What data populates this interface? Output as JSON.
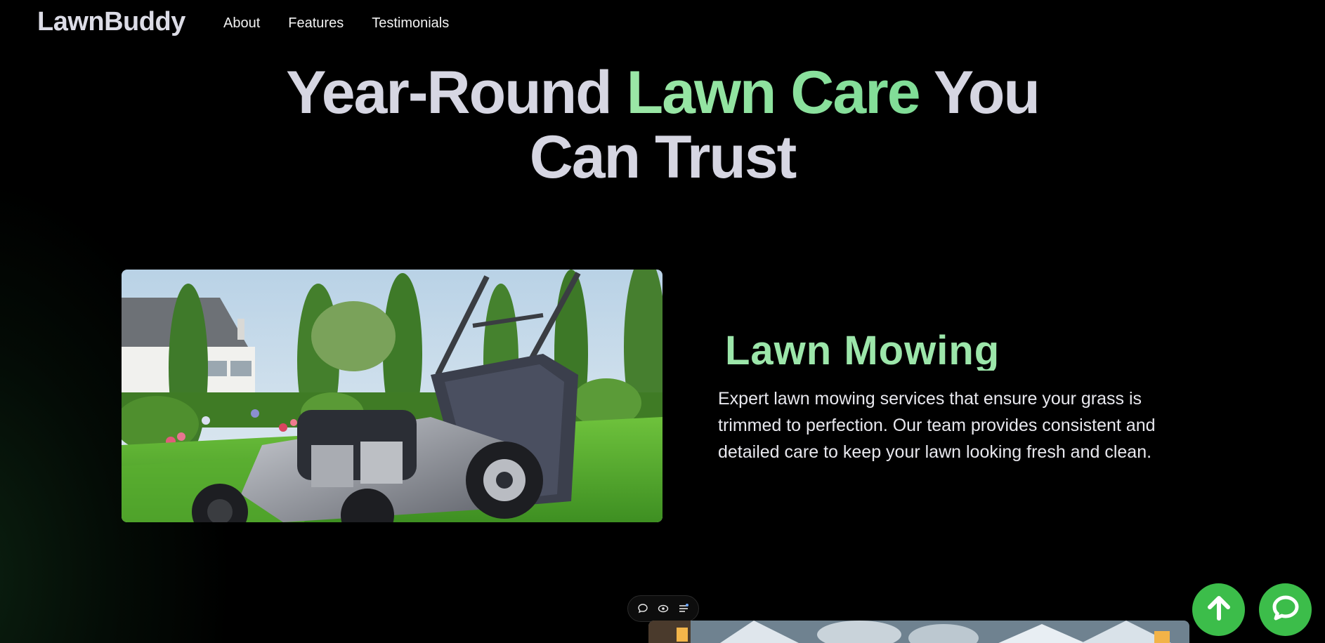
{
  "brand": {
    "logo": "LawnBuddy"
  },
  "nav": {
    "links": [
      "About",
      "Features",
      "Testimonials"
    ]
  },
  "hero": {
    "part1": "Year-Round",
    "accent": "Lawn Care",
    "part2": "You",
    "line2": "Can Trust"
  },
  "feature": {
    "title": "Lawn Mowing",
    "description": "Expert lawn mowing services that ensure your grass is trimmed to perfection. Our team provides consistent and detailed care to keep your lawn looking fresh and clean."
  },
  "colors": {
    "accent_green": "#9ce6aa",
    "fab_green": "#3cbd4a",
    "background": "#000000"
  },
  "icons": {
    "scroll_top": "arrow-up-icon",
    "chat": "chat-bubble-icon",
    "toolbar": [
      "comment-icon",
      "eye-icon",
      "menu-lines-icon"
    ]
  }
}
